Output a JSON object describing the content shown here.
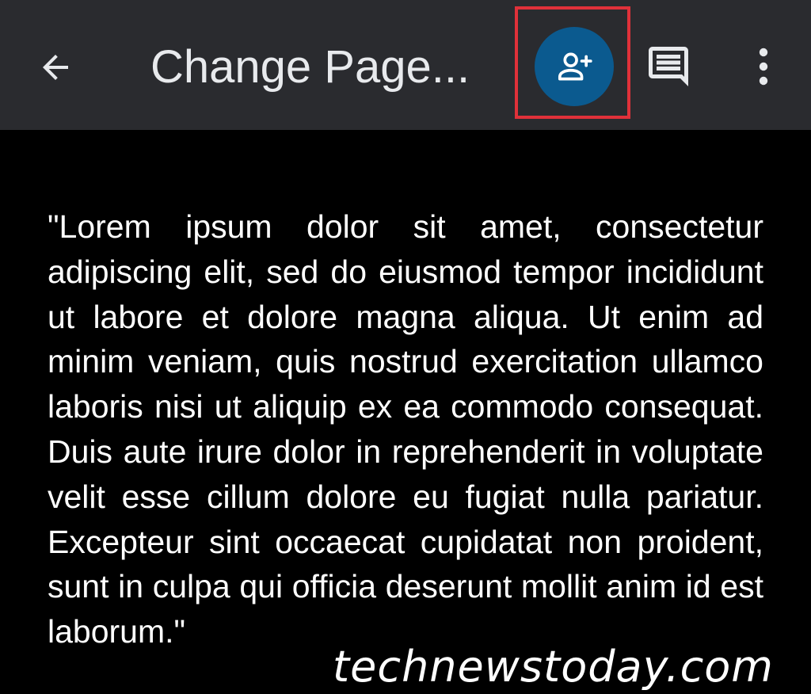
{
  "toolbar": {
    "title": "Change Page...",
    "icons": {
      "back": "arrow-back-icon",
      "share": "person-add-icon",
      "comment": "comment-icon",
      "more": "more-vert-icon"
    },
    "colors": {
      "background": "#2a2b2f",
      "share_button": "#0b5a8f",
      "highlight": "#e0313a",
      "icon": "#e8eaed"
    }
  },
  "document": {
    "body": "\"Lorem ipsum dolor sit amet, consectetur adipiscing elit, sed do eiusmod tempor incididunt ut labore et dolore magna aliqua. Ut enim ad minim veniam, quis nostrud exercitation ullamco laboris nisi ut aliquip ex ea commodo consequat. Duis aute irure dolor in reprehenderit in voluptate velit esse cillum dolore eu fugiat nulla pariatur. Excepteur sint occaecat cupidatat non proident, sunt in culpa qui officia deserunt mollit anim id est laborum.\"",
    "colors": {
      "background": "#000000",
      "text": "#ffffff"
    }
  },
  "watermark": {
    "text": "technewstoday.com"
  }
}
